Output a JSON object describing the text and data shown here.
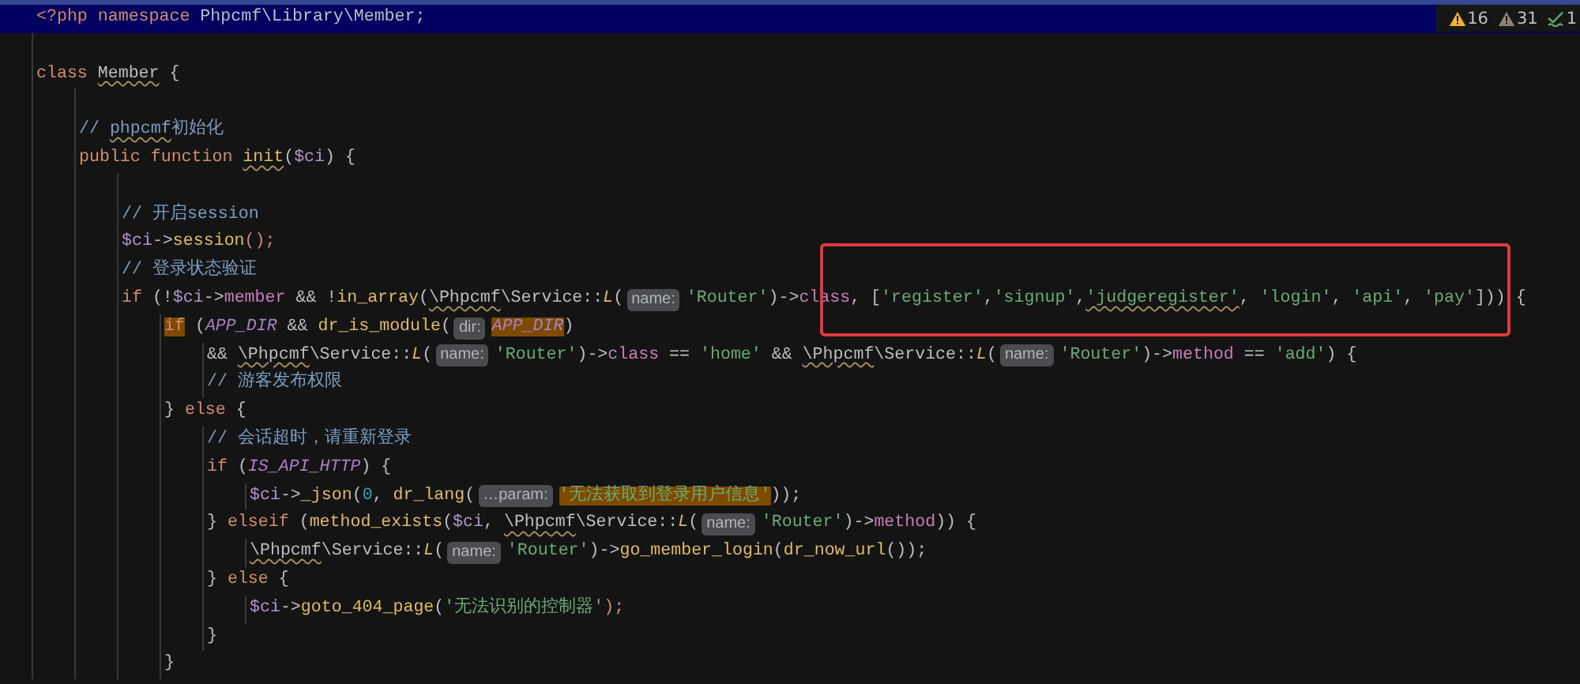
{
  "inspections": [
    {
      "kind": "warning",
      "count": "16"
    },
    {
      "kind": "weak_warning",
      "count": "31"
    },
    {
      "kind": "typo",
      "count": "1"
    }
  ],
  "lines": [
    {
      "kind": "current",
      "tokens": [
        {
          "text": "<?php",
          "kind": "tag"
        },
        {
          "text": " namespace",
          "kind": "kw"
        },
        {
          "text": " Phpcmf\\Library\\Member;",
          "kind": "plain"
        }
      ]
    },
    {
      "kind": "blank"
    },
    {
      "kind": "code",
      "tokens": [
        {
          "text": "class ",
          "kind": "kw"
        },
        {
          "text": "Member",
          "kind": "plain",
          "squiggle": true
        },
        {
          "text": " {",
          "kind": "plain"
        }
      ],
      "children": [
        {
          "kind": "blank"
        },
        {
          "kind": "code",
          "tokens": [
            {
              "text": "// ",
              "kind": "comment"
            },
            {
              "text": "phpcmf",
              "kind": "comment",
              "squiggle": true
            },
            {
              "text": "初始化",
              "kind": "comment"
            }
          ]
        },
        {
          "kind": "code",
          "tokens": [
            {
              "text": "public function ",
              "kind": "kw"
            },
            {
              "text": "init",
              "kind": "fn",
              "squiggle": true
            },
            {
              "text": "(",
              "kind": "plain"
            },
            {
              "text": "$ci",
              "kind": "var"
            },
            {
              "text": ") {",
              "kind": "plain"
            }
          ],
          "children": [
            {
              "kind": "blank"
            },
            {
              "kind": "code",
              "tokens": [
                {
                  "text": "// 开启session",
                  "kind": "comment"
                }
              ]
            },
            {
              "kind": "code",
              "tokens": [
                {
                  "text": "$ci",
                  "kind": "var"
                },
                {
                  "text": "->",
                  "kind": "plain"
                },
                {
                  "text": "session",
                  "kind": "fn"
                },
                {
                  "text": "();",
                  "kind": "kw"
                }
              ]
            },
            {
              "kind": "code",
              "tokens": [
                {
                  "text": "// 登录状态验证",
                  "kind": "comment"
                }
              ]
            },
            {
              "kind": "code",
              "tokens": [
                {
                  "text": "if",
                  "kind": "kw"
                },
                {
                  "text": " (!",
                  "kind": "plain"
                },
                {
                  "text": "$ci",
                  "kind": "var"
                },
                {
                  "text": "->",
                  "kind": "plain"
                },
                {
                  "text": "member",
                  "kind": "prop"
                },
                {
                  "text": " && !",
                  "kind": "plain"
                },
                {
                  "text": "in_array",
                  "kind": "fn"
                },
                {
                  "text": "(",
                  "kind": "plain"
                },
                {
                  "text": "\\Phpcmf",
                  "kind": "plain",
                  "squiggle": true
                },
                {
                  "text": "\\Service::",
                  "kind": "plain"
                },
                {
                  "text": "L",
                  "kind": "static"
                },
                {
                  "text": "(",
                  "kind": "plain"
                },
                {
                  "text": "name:",
                  "kind": "hint"
                },
                {
                  "text": "'Router'",
                  "kind": "str"
                },
                {
                  "text": ")->",
                  "kind": "plain"
                },
                {
                  "text": "class",
                  "kind": "prop"
                },
                {
                  "text": ", [",
                  "kind": "plain"
                },
                {
                  "text": "'register'",
                  "kind": "str"
                },
                {
                  "text": ",",
                  "kind": "plain"
                },
                {
                  "text": "'signup'",
                  "kind": "str"
                },
                {
                  "text": ",",
                  "kind": "plain"
                },
                {
                  "text": "'judgeregister'",
                  "kind": "str",
                  "squiggle": true
                },
                {
                  "text": ", ",
                  "kind": "plain"
                },
                {
                  "text": "'login'",
                  "kind": "str"
                },
                {
                  "text": ", ",
                  "kind": "plain"
                },
                {
                  "text": "'api'",
                  "kind": "str"
                },
                {
                  "text": ", ",
                  "kind": "plain"
                },
                {
                  "text": "'pay'",
                  "kind": "str"
                },
                {
                  "text": "])) {",
                  "kind": "plain"
                }
              ],
              "children": [
                {
                  "kind": "code",
                  "tokens": [
                    {
                      "text": "if",
                      "kind": "kw",
                      "highlight": true
                    },
                    {
                      "text": " (",
                      "kind": "plain"
                    },
                    {
                      "text": "APP_DIR",
                      "kind": "const"
                    },
                    {
                      "text": " && ",
                      "kind": "plain"
                    },
                    {
                      "text": "dr_is_module",
                      "kind": "fn"
                    },
                    {
                      "text": "(",
                      "kind": "plain"
                    },
                    {
                      "text": "dir:",
                      "kind": "hint"
                    },
                    {
                      "text": "APP_DIR",
                      "kind": "const",
                      "highlight": true
                    },
                    {
                      "text": ")",
                      "kind": "plain"
                    }
                  ],
                  "children": [
                    {
                      "kind": "code",
                      "tokens": [
                        {
                          "text": "&& ",
                          "kind": "plain"
                        },
                        {
                          "text": "\\Phpcmf",
                          "kind": "plain",
                          "squiggle": true
                        },
                        {
                          "text": "\\Service::",
                          "kind": "plain"
                        },
                        {
                          "text": "L",
                          "kind": "static"
                        },
                        {
                          "text": "(",
                          "kind": "plain"
                        },
                        {
                          "text": "name:",
                          "kind": "hint"
                        },
                        {
                          "text": "'Router'",
                          "kind": "str"
                        },
                        {
                          "text": ")->",
                          "kind": "plain"
                        },
                        {
                          "text": "class",
                          "kind": "prop"
                        },
                        {
                          "text": " == ",
                          "kind": "plain"
                        },
                        {
                          "text": "'home'",
                          "kind": "str"
                        },
                        {
                          "text": " && ",
                          "kind": "plain"
                        },
                        {
                          "text": "\\Phpcmf",
                          "kind": "plain",
                          "squiggle": true
                        },
                        {
                          "text": "\\Service::",
                          "kind": "plain"
                        },
                        {
                          "text": "L",
                          "kind": "static"
                        },
                        {
                          "text": "(",
                          "kind": "plain"
                        },
                        {
                          "text": "name:",
                          "kind": "hint"
                        },
                        {
                          "text": "'Router'",
                          "kind": "str"
                        },
                        {
                          "text": ")->",
                          "kind": "plain"
                        },
                        {
                          "text": "method",
                          "kind": "prop"
                        },
                        {
                          "text": " == ",
                          "kind": "plain"
                        },
                        {
                          "text": "'add'",
                          "kind": "str"
                        },
                        {
                          "text": ") {",
                          "kind": "plain"
                        }
                      ]
                    },
                    {
                      "kind": "code",
                      "tokens": [
                        {
                          "text": "// 游客发布权限",
                          "kind": "comment"
                        }
                      ]
                    }
                  ]
                },
                {
                  "kind": "code",
                  "tokens": [
                    {
                      "text": "} ",
                      "kind": "plain"
                    },
                    {
                      "text": "else",
                      "kind": "kw"
                    },
                    {
                      "text": " {",
                      "kind": "plain"
                    }
                  ],
                  "children": [
                    {
                      "kind": "code",
                      "tokens": [
                        {
                          "text": "// 会话超时，请重新登录",
                          "kind": "comment"
                        }
                      ]
                    },
                    {
                      "kind": "code",
                      "tokens": [
                        {
                          "text": "if",
                          "kind": "kw"
                        },
                        {
                          "text": " (",
                          "kind": "plain"
                        },
                        {
                          "text": "IS_API_HTTP",
                          "kind": "const"
                        },
                        {
                          "text": ") {",
                          "kind": "plain"
                        }
                      ],
                      "children": [
                        {
                          "kind": "code",
                          "tokens": [
                            {
                              "text": "$ci",
                              "kind": "var"
                            },
                            {
                              "text": "->",
                              "kind": "plain"
                            },
                            {
                              "text": "_json",
                              "kind": "fn"
                            },
                            {
                              "text": "(",
                              "kind": "plain"
                            },
                            {
                              "text": "0",
                              "kind": "num"
                            },
                            {
                              "text": ", ",
                              "kind": "plain"
                            },
                            {
                              "text": "dr_lang",
                              "kind": "fn"
                            },
                            {
                              "text": "(",
                              "kind": "plain"
                            },
                            {
                              "text": "…param:",
                              "kind": "hint"
                            },
                            {
                              "text": "'无法获取到登录用户信息'",
                              "kind": "str",
                              "highlight": true
                            },
                            {
                              "text": "));",
                              "kind": "plain"
                            }
                          ]
                        }
                      ]
                    },
                    {
                      "kind": "code",
                      "tokens": [
                        {
                          "text": "} ",
                          "kind": "plain"
                        },
                        {
                          "text": "elseif",
                          "kind": "kw"
                        },
                        {
                          "text": " (",
                          "kind": "plain"
                        },
                        {
                          "text": "method_exists",
                          "kind": "fn"
                        },
                        {
                          "text": "(",
                          "kind": "plain"
                        },
                        {
                          "text": "$ci",
                          "kind": "var"
                        },
                        {
                          "text": ", ",
                          "kind": "plain"
                        },
                        {
                          "text": "\\Phpcmf",
                          "kind": "plain",
                          "squiggle": true
                        },
                        {
                          "text": "\\Service::",
                          "kind": "plain"
                        },
                        {
                          "text": "L",
                          "kind": "static"
                        },
                        {
                          "text": "(",
                          "kind": "plain"
                        },
                        {
                          "text": "name:",
                          "kind": "hint"
                        },
                        {
                          "text": "'Router'",
                          "kind": "str"
                        },
                        {
                          "text": ")->",
                          "kind": "plain"
                        },
                        {
                          "text": "method",
                          "kind": "prop"
                        },
                        {
                          "text": ")) {",
                          "kind": "plain"
                        }
                      ],
                      "children": [
                        {
                          "kind": "code",
                          "tokens": [
                            {
                              "text": "\\Phpcmf",
                              "kind": "plain",
                              "squiggle": true
                            },
                            {
                              "text": "\\Service::",
                              "kind": "plain"
                            },
                            {
                              "text": "L",
                              "kind": "static"
                            },
                            {
                              "text": "(",
                              "kind": "plain"
                            },
                            {
                              "text": "name:",
                              "kind": "hint"
                            },
                            {
                              "text": "'Router'",
                              "kind": "str"
                            },
                            {
                              "text": ")->",
                              "kind": "plain"
                            },
                            {
                              "text": "go_member_login",
                              "kind": "fn"
                            },
                            {
                              "text": "(",
                              "kind": "plain"
                            },
                            {
                              "text": "dr_now_url",
                              "kind": "fn"
                            },
                            {
                              "text": "());",
                              "kind": "plain"
                            }
                          ]
                        }
                      ]
                    },
                    {
                      "kind": "code",
                      "tokens": [
                        {
                          "text": "} ",
                          "kind": "plain"
                        },
                        {
                          "text": "else",
                          "kind": "kw"
                        },
                        {
                          "text": " {",
                          "kind": "plain"
                        }
                      ],
                      "children": [
                        {
                          "kind": "code",
                          "tokens": [
                            {
                              "text": "$ci",
                              "kind": "var"
                            },
                            {
                              "text": "->",
                              "kind": "plain"
                            },
                            {
                              "text": "goto_404_page",
                              "kind": "fn"
                            },
                            {
                              "text": "(",
                              "kind": "plain"
                            },
                            {
                              "text": "'无法识别的控制器'",
                              "kind": "str"
                            },
                            {
                              "text": ");",
                              "kind": "kw"
                            }
                          ]
                        }
                      ]
                    },
                    {
                      "kind": "code",
                      "tokens": [
                        {
                          "text": "}",
                          "kind": "plain"
                        }
                      ]
                    }
                  ]
                },
                {
                  "kind": "code",
                  "tokens": [
                    {
                      "text": "}",
                      "kind": "plain"
                    }
                  ]
                }
              ]
            }
          ]
        }
      ]
    }
  ]
}
